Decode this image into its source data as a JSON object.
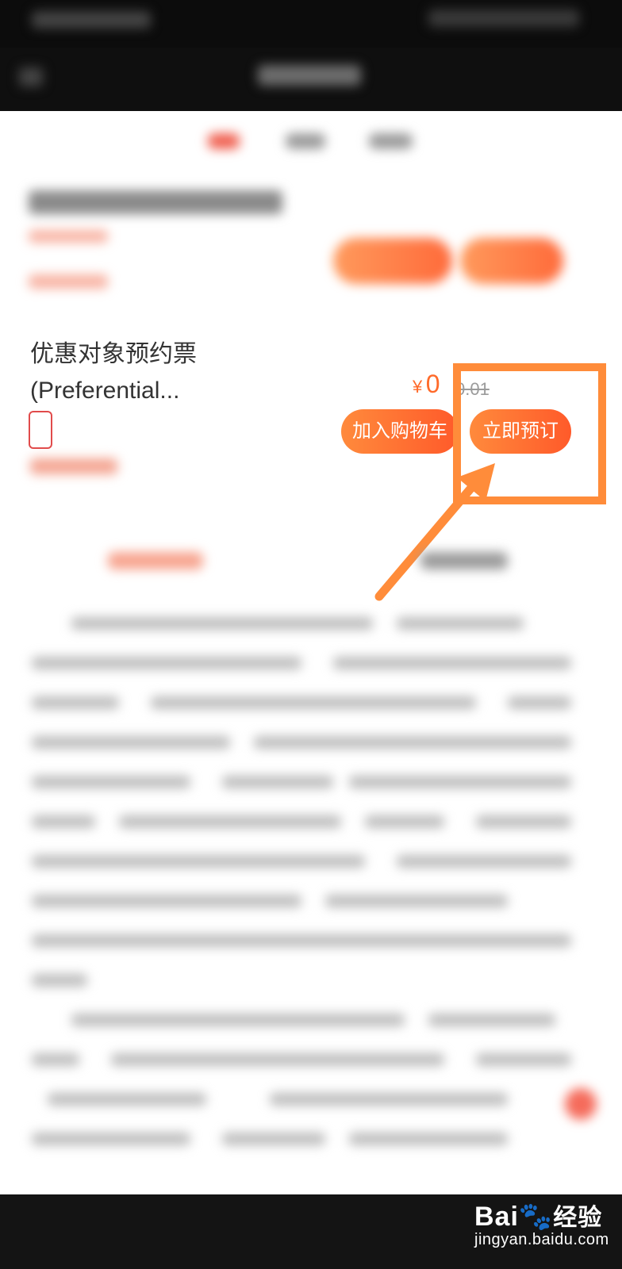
{
  "product": {
    "title_line1": "优惠对象预约票",
    "title_line2": "(Preferential...",
    "price_symbol": "¥",
    "price": "0",
    "original_price": "0.01",
    "add_to_cart_label": "加入购物车",
    "book_now_label": "立即预订"
  },
  "colors": {
    "accent": "#ff6a2a",
    "highlight": "#ff8c3a"
  },
  "watermark": {
    "brand": "Bai",
    "brand_cn": "经验",
    "url": "jingyan.baidu.com"
  }
}
